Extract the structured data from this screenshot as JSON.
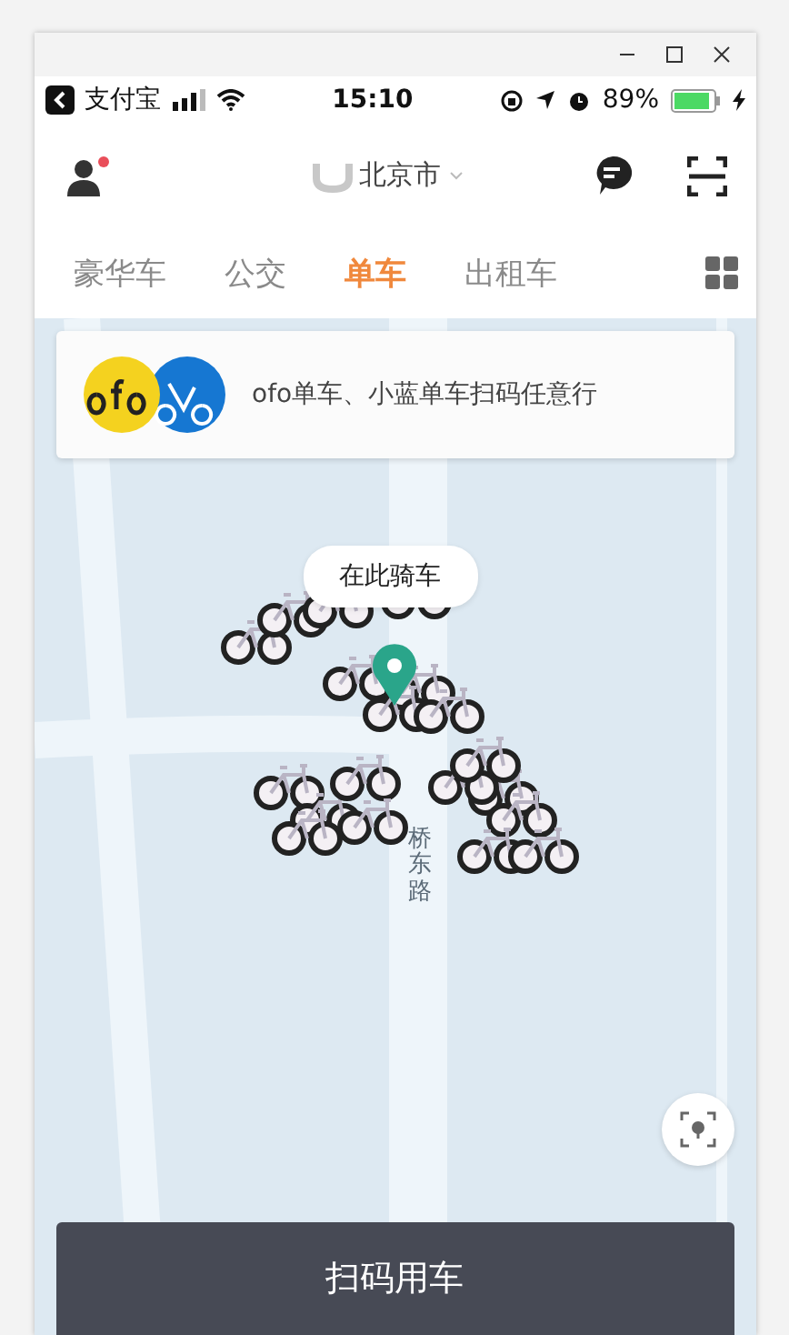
{
  "status_bar": {
    "back_app": "支付宝",
    "time": "15:10",
    "battery": "89%"
  },
  "header": {
    "city": "北京市",
    "profile_notification": true
  },
  "tabs": [
    {
      "label": "豪华车",
      "selected": false
    },
    {
      "label": "公交",
      "selected": false
    },
    {
      "label": "单车",
      "selected": true
    },
    {
      "label": "出租车",
      "selected": false
    }
  ],
  "banner": {
    "text": "ofo单车、小蓝单车扫码任意行"
  },
  "map": {
    "pin_label": "在此骑车",
    "road_label": "桥东路"
  },
  "action_button": "扫码用车"
}
